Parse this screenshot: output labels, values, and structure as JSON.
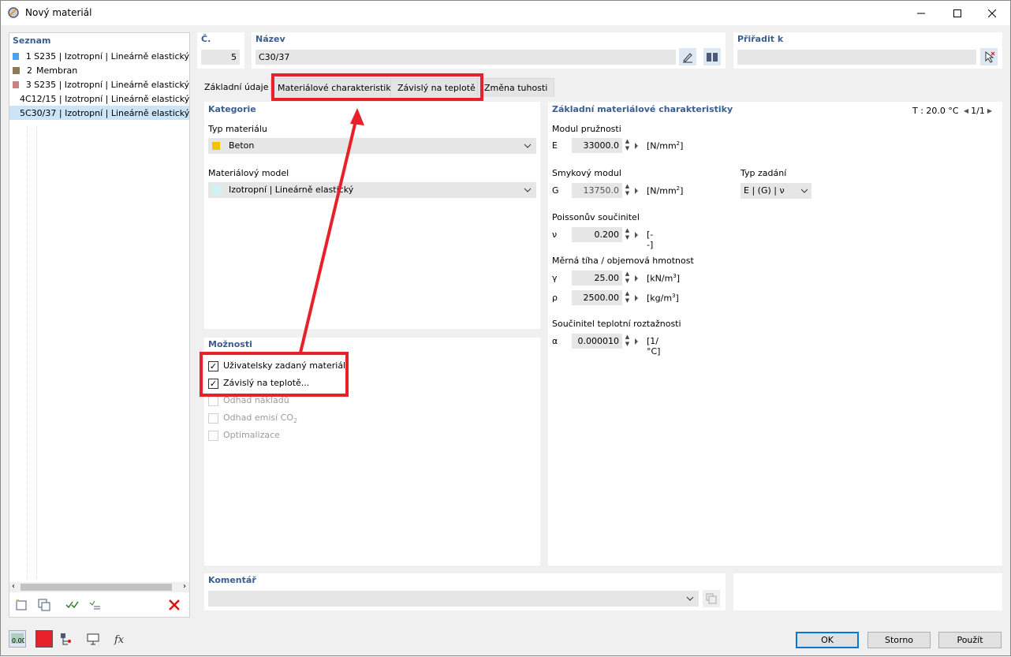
{
  "window": {
    "title": "Nový materiál"
  },
  "list": {
    "header": "Seznam",
    "items": [
      {
        "num": "1",
        "label": "S235 | Izotropní | Lineárně elastický",
        "color": "#4aa3f0"
      },
      {
        "num": "2",
        "label": "Membran",
        "color": "#8b7b5a"
      },
      {
        "num": "3",
        "label": "S235 | Izotropní | Lineárně elastický",
        "color": "#c98080"
      },
      {
        "num": "4",
        "label": "C12/15 | Izotropní | Lineárně elastický",
        "color": "#5fb82a"
      },
      {
        "num": "5",
        "label": "C30/37 | Izotropní | Lineárně elastický",
        "color": "#a8143c"
      }
    ]
  },
  "number": {
    "label": "Č.",
    "value": "5"
  },
  "name": {
    "label": "Název",
    "value": "C30/37"
  },
  "assign": {
    "label": "Přiřadit k",
    "value": ""
  },
  "tabs": [
    "Základní údaje",
    "Materiálové charakteristiky",
    "Závislý na teplotě",
    "Změna tuhosti"
  ],
  "category": {
    "header": "Kategorie",
    "type_label": "Typ materiálu",
    "type_value": "Beton",
    "type_color": "#f5c200",
    "model_label": "Materiálový model",
    "model_value": "Izotropní | Lineárně elastický",
    "model_color": "#cdf3f5"
  },
  "options": {
    "header": "Možnosti",
    "items": [
      {
        "label": "Uživatelsky zadaný materiál",
        "checked": true,
        "enabled": true
      },
      {
        "label": "Závislý na teplotě...",
        "checked": true,
        "enabled": true
      },
      {
        "label": "Odhad nákladů",
        "checked": false,
        "enabled": false
      },
      {
        "label": "Odhad emisí CO",
        "sub": "2",
        "checked": false,
        "enabled": false
      },
      {
        "label": "Optimalizace",
        "checked": false,
        "enabled": false
      }
    ]
  },
  "props": {
    "header": "Základní materiálové charakteristiky",
    "temp": "T : 20.0 °C",
    "page": "1/1",
    "elastic_label": "Modul pružnosti",
    "E": {
      "sym": "E",
      "value": "33000.0",
      "unit": "[N/mm",
      "sup": "2",
      "unit_end": "]"
    },
    "shear_label": "Smykový modul",
    "G": {
      "sym": "G",
      "value": "13750.0",
      "unit": "[N/mm",
      "sup": "2",
      "unit_end": "]"
    },
    "input_type_label": "Typ zadání",
    "input_type_value": "E | (G) | ν",
    "poisson_label": "Poissonův součinitel",
    "nu": {
      "sym": "ν",
      "value": "0.200",
      "unit": "[--]"
    },
    "weight_label": "Měrná tíha / objemová hmotnost",
    "gamma": {
      "sym": "γ",
      "value": "25.00",
      "unit": "[kN/m",
      "sup": "3",
      "unit_end": "]"
    },
    "rho": {
      "sym": "ρ",
      "value": "2500.00",
      "unit": "[kg/m",
      "sup": "3",
      "unit_end": "]"
    },
    "thermal_label": "Součinitel teplotní roztažnosti",
    "alpha": {
      "sym": "α",
      "value": "0.000010",
      "unit": "[1/°C]"
    }
  },
  "comment": {
    "label": "Komentář",
    "value": ""
  },
  "buttons": {
    "ok": "OK",
    "cancel": "Storno",
    "apply": "Použít"
  },
  "status_value": "0.00",
  "highlight_color": "#e8202a"
}
